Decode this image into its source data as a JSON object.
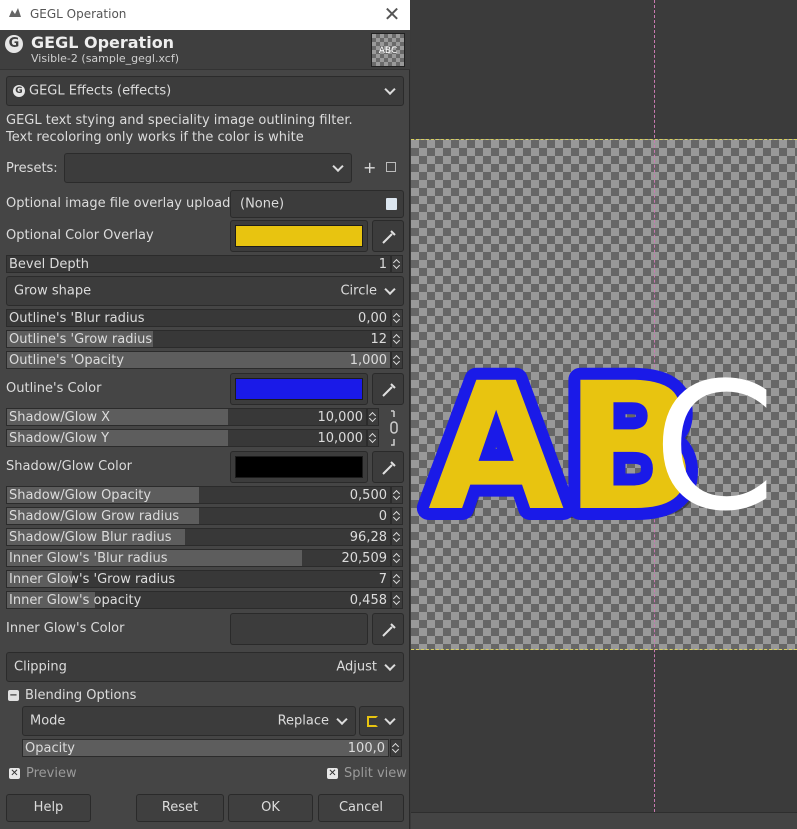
{
  "window": {
    "title": "GEGL Operation"
  },
  "header": {
    "title": "GEGL Operation",
    "subtitle": "Visible-2 (sample_gegl.xcf)",
    "thumb_text": "ABC"
  },
  "effect_selector": {
    "value": "GEGL Effects (effects)"
  },
  "description": {
    "line1": "GEGL text stying and speciality image outlining filter.",
    "line2": "Text recoloring only works if the color is white"
  },
  "presets": {
    "label": "Presets:",
    "value": ""
  },
  "overlay_upload": {
    "label": "Optional image file overlay upload",
    "value": "(None)"
  },
  "color_overlay": {
    "label": "Optional Color Overlay",
    "color": "#e8c410"
  },
  "bevel_depth": {
    "label": "Bevel Depth",
    "value": "1",
    "fraction": 0.0
  },
  "grow_shape": {
    "label": "Grow shape",
    "value": "Circle"
  },
  "outline_blur": {
    "label": "Outline's 'Blur radius",
    "value": "0,00",
    "fraction": 0.0
  },
  "outline_grow": {
    "label": "Outline's 'Grow radius",
    "value": "12",
    "fraction": 0.38
  },
  "outline_opacity": {
    "label": "Outline's 'Opacity",
    "value": "1,000",
    "fraction": 1.0
  },
  "outline_color": {
    "label": "Outline's Color",
    "color": "#1a1ae8"
  },
  "shadow_x": {
    "label": "Shadow/Glow X",
    "value": "10,000",
    "fraction": 0.615
  },
  "shadow_y": {
    "label": "Shadow/Glow Y",
    "value": "10,000",
    "fraction": 0.615
  },
  "shadow_color": {
    "label": "Shadow/Glow Color",
    "color": "#000000"
  },
  "shadow_opacity": {
    "label": "Shadow/Glow Opacity",
    "value": "0,500",
    "fraction": 0.5
  },
  "shadow_grow": {
    "label": "Shadow/Glow Grow radius",
    "value": "0",
    "fraction": 0.5
  },
  "shadow_blur": {
    "label": "Shadow/Glow Blur radius",
    "value": "96,28",
    "fraction": 0.465
  },
  "inner_blur": {
    "label": "Inner Glow's 'Blur radius",
    "value": "20,509",
    "fraction": 0.77
  },
  "inner_grow": {
    "label": "Inner Glow's 'Grow radius",
    "value": "7",
    "fraction": 0.17
  },
  "inner_opacity": {
    "label": "Inner Glow's opacity",
    "value": "0,458",
    "fraction": 0.23
  },
  "inner_color": {
    "label": "Inner Glow's Color",
    "color": "#3c3c3c"
  },
  "clipping": {
    "label": "Clipping",
    "value": "Adjust"
  },
  "blending": {
    "label": "Blending Options",
    "mode_label": "Mode",
    "mode_value": "Replace",
    "opacity_label": "Opacity",
    "opacity_value": "100,0",
    "opacity_fraction": 1.0
  },
  "preview": {
    "label": "Preview",
    "split_label": "Split view"
  },
  "buttons": {
    "help": "Help",
    "reset": "Reset",
    "ok": "OK",
    "cancel": "Cancel"
  },
  "canvas": {
    "text_ab": "AB",
    "text_c": "C",
    "fill_color": "#e8c410",
    "outline_color": "#1a1ae8",
    "plain_color": "#ffffff"
  }
}
